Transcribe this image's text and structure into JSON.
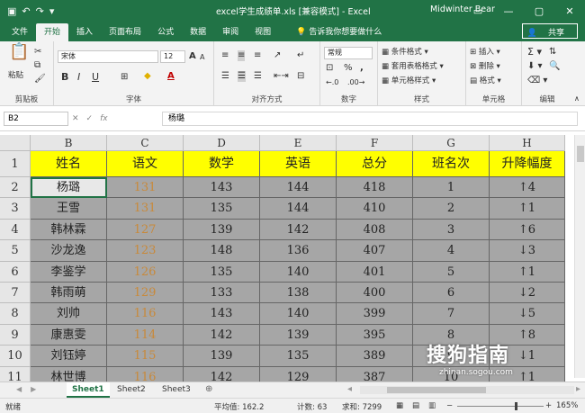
{
  "title_bar": {
    "quick_access": [
      "save",
      "undo",
      "redo",
      "customize"
    ],
    "title": "excel学生成绩单.xls  [兼容模式] - Excel",
    "user": "Midwinter Bear",
    "window_buttons": [
      "ribbon-options",
      "minimize",
      "restore",
      "close"
    ]
  },
  "ribbon_tabs": [
    "文件",
    "开始",
    "插入",
    "页面布局",
    "公式",
    "数据",
    "审阅",
    "视图"
  ],
  "active_tab": "开始",
  "tell_me": "告诉我你想要做什么",
  "share": "共享",
  "ribbon": {
    "clipboard": {
      "paste": "粘贴",
      "label": "剪贴板"
    },
    "font": {
      "name": "宋体",
      "size": "12",
      "bold": "B",
      "italic": "I",
      "underline": "U",
      "grow": "A",
      "shrink": "A",
      "label": "字体"
    },
    "alignment": {
      "label": "对齐方式"
    },
    "number": {
      "format": "常规",
      "percent": "%",
      "comma": ",",
      "label": "数字"
    },
    "styles": {
      "conditional": "条件格式",
      "table": "套用表格格式",
      "cell_styles": "单元格样式",
      "label": "样式"
    },
    "cells": {
      "insert": "插入",
      "delete": "删除",
      "format": "格式",
      "label": "单元格"
    },
    "editing": {
      "label": "编辑"
    }
  },
  "formula_bar": {
    "name_box": "B2",
    "fx": "fx",
    "value": "杨璐"
  },
  "columns": [
    "B",
    "C",
    "D",
    "E",
    "F",
    "G",
    "H"
  ],
  "row_numbers": [
    "1",
    "2",
    "3",
    "4",
    "5",
    "6",
    "7",
    "8",
    "9",
    "10",
    "11"
  ],
  "headers": [
    "姓名",
    "语文",
    "数学",
    "英语",
    "总分",
    "班名次",
    "升降幅度"
  ],
  "rows": [
    [
      "杨璐",
      "131",
      "143",
      "144",
      "418",
      "1",
      "↑4"
    ],
    [
      "王雪",
      "131",
      "135",
      "144",
      "410",
      "2",
      "↑1"
    ],
    [
      "韩林霖",
      "127",
      "139",
      "142",
      "408",
      "3",
      "↑6"
    ],
    [
      "沙龙逸",
      "123",
      "148",
      "136",
      "407",
      "4",
      "↓3"
    ],
    [
      "李鉴学",
      "126",
      "135",
      "140",
      "401",
      "5",
      "↑1"
    ],
    [
      "韩雨萌",
      "129",
      "133",
      "138",
      "400",
      "6",
      "↓2"
    ],
    [
      "刘帅",
      "116",
      "143",
      "140",
      "399",
      "7",
      "↓5"
    ],
    [
      "康惠雯",
      "114",
      "142",
      "139",
      "395",
      "8",
      "↑8"
    ],
    [
      "刘钰婷",
      "115",
      "139",
      "135",
      "389",
      "9",
      "↓1"
    ],
    [
      "林世博",
      "116",
      "142",
      "129",
      "387",
      "10",
      "↑1"
    ]
  ],
  "sheets": [
    "Sheet1",
    "Sheet2",
    "Sheet3"
  ],
  "active_sheet": "Sheet1",
  "status": {
    "ready": "就绪",
    "average": "平均值: 162.2",
    "count": "计数: 63",
    "sum": "求和: 7299",
    "zoom": "165%"
  },
  "watermark": {
    "text": "搜狗指南",
    "url": "zhinan.sogou.com"
  },
  "colors": {
    "excel_green": "#217346",
    "header_fill": "#ffff00",
    "body_fill": "#a6a6a6",
    "chinese_score": "#c8893a"
  }
}
